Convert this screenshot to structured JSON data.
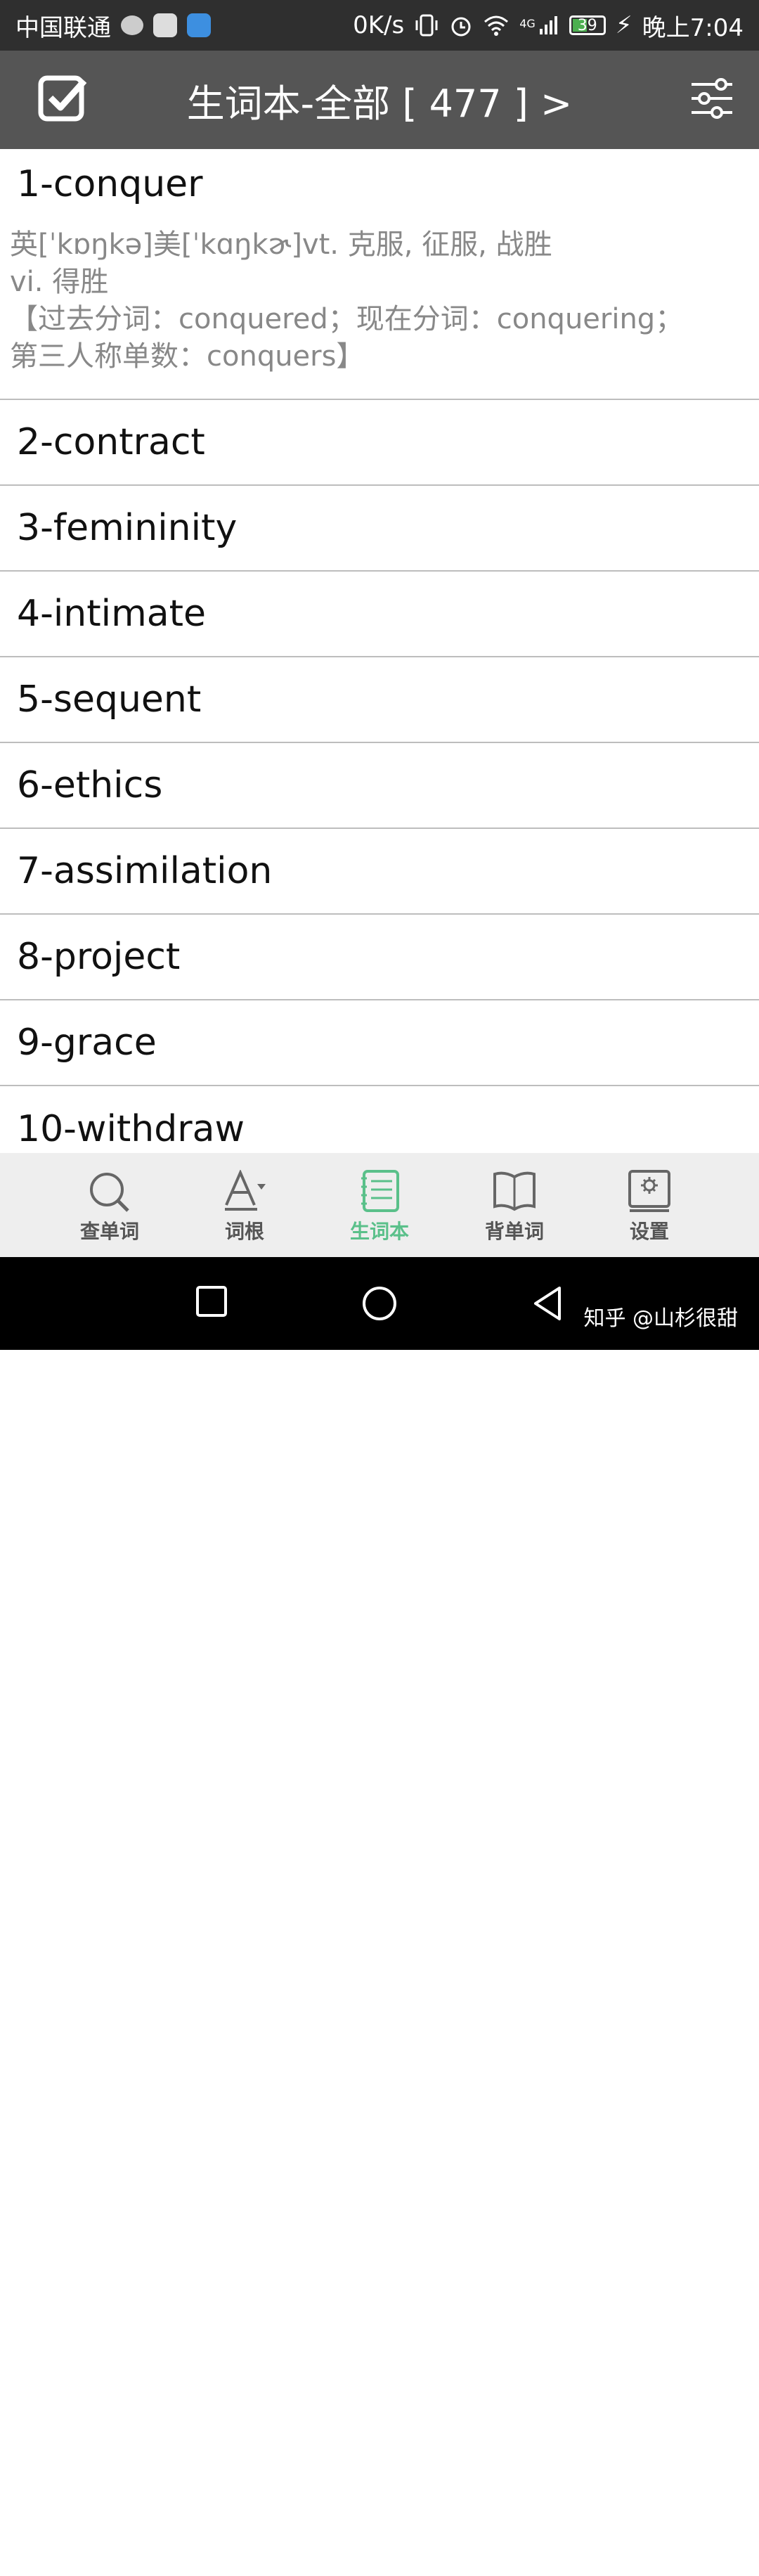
{
  "status": {
    "carrier": "中国联通",
    "net_speed": "0K/s",
    "network": "4G",
    "battery": "39",
    "time": "晚上7:04"
  },
  "appbar": {
    "title": "生词本-全部 [ 477 ] >"
  },
  "entries": [
    {
      "word": "1-conquer",
      "definition": [
        "英[ˈkɒŋkə]美[ˈkɑŋkɚ]vt. 克服, 征服, 战胜",
        "vi. 得胜",
        "【过去分词：conquered；现在分词：conquering；",
        "第三人称单数：conquers】"
      ]
    },
    {
      "word": "2-contract"
    },
    {
      "word": "3-femininity"
    },
    {
      "word": "4-intimate"
    },
    {
      "word": "5-sequent"
    },
    {
      "word": "6-ethics"
    },
    {
      "word": "7-assimilation"
    },
    {
      "word": "8-project"
    },
    {
      "word": "9-grace"
    },
    {
      "word": "10-withdraw"
    }
  ],
  "tabs": [
    {
      "label": "查单词",
      "icon": "search-icon"
    },
    {
      "label": "词根",
      "icon": "font-icon"
    },
    {
      "label": "生词本",
      "icon": "notebook-icon"
    },
    {
      "label": "背单词",
      "icon": "book-icon"
    },
    {
      "label": "设置",
      "icon": "settings-icon"
    }
  ],
  "active_tab": "生词本",
  "accent_color": "#5ac08a",
  "watermark": "知乎 @山杉很甜"
}
